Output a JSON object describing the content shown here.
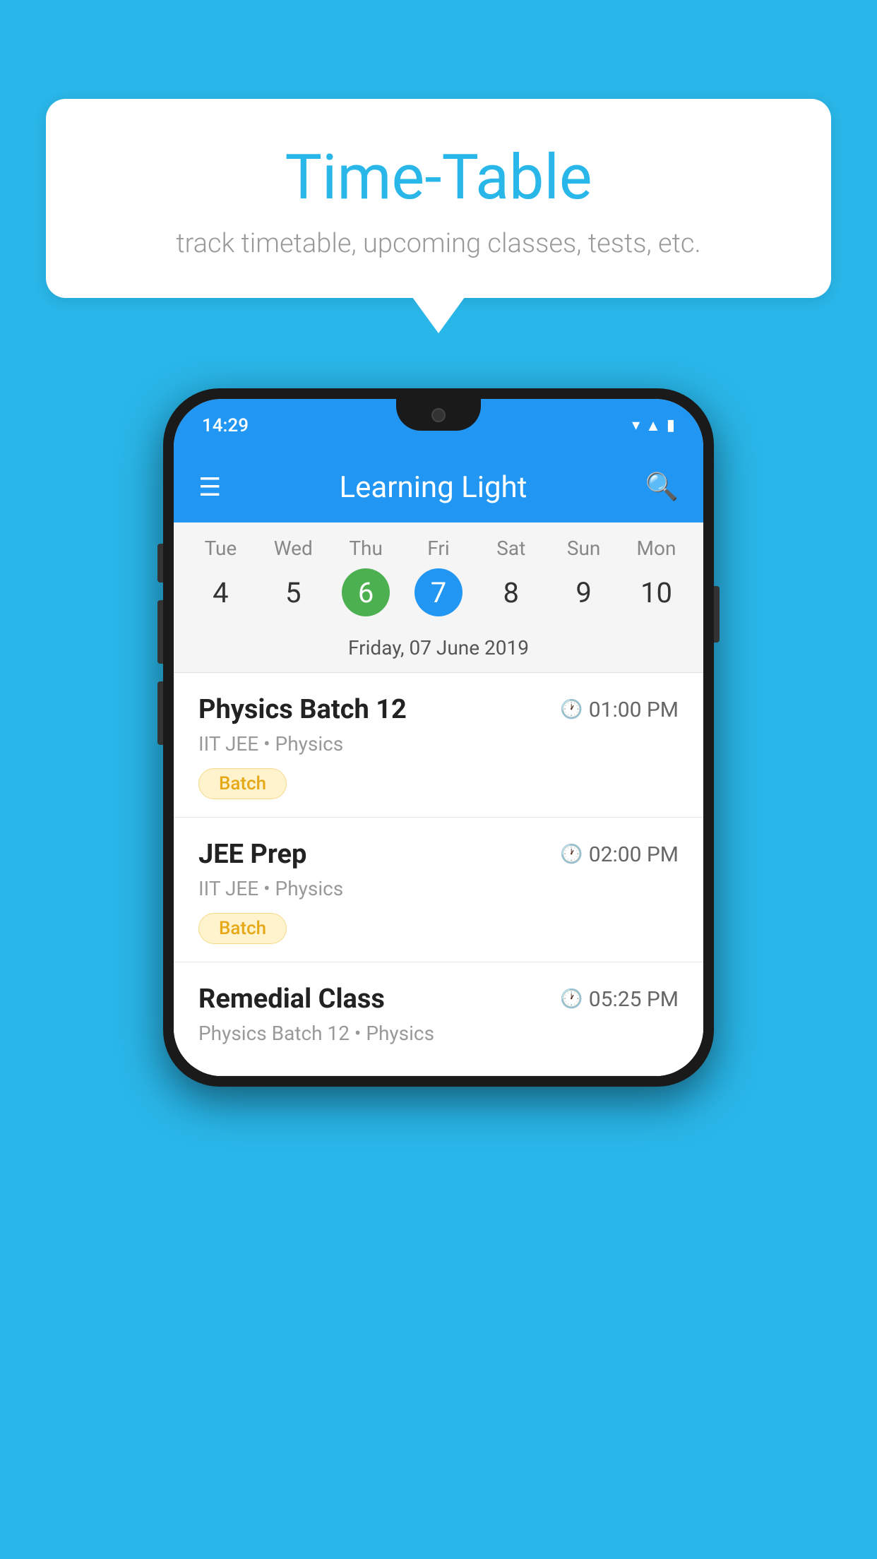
{
  "background_color": "#29B6E8",
  "bubble": {
    "title": "Time-Table",
    "subtitle": "track timetable, upcoming classes, tests, etc."
  },
  "phone": {
    "status_bar": {
      "time": "14:29"
    },
    "app_bar": {
      "title": "Learning Light"
    },
    "calendar": {
      "days": [
        {
          "name": "Tue",
          "num": "4",
          "state": "normal"
        },
        {
          "name": "Wed",
          "num": "5",
          "state": "normal"
        },
        {
          "name": "Thu",
          "num": "6",
          "state": "today"
        },
        {
          "name": "Fri",
          "num": "7",
          "state": "selected"
        },
        {
          "name": "Sat",
          "num": "8",
          "state": "normal"
        },
        {
          "name": "Sun",
          "num": "9",
          "state": "normal"
        },
        {
          "name": "Mon",
          "num": "10",
          "state": "normal"
        }
      ],
      "selected_date": "Friday, 07 June 2019"
    },
    "schedule": [
      {
        "title": "Physics Batch 12",
        "time": "01:00 PM",
        "subtitle": "IIT JEE • Physics",
        "badge": "Batch"
      },
      {
        "title": "JEE Prep",
        "time": "02:00 PM",
        "subtitle": "IIT JEE • Physics",
        "badge": "Batch"
      },
      {
        "title": "Remedial Class",
        "time": "05:25 PM",
        "subtitle": "Physics Batch 12 • Physics",
        "badge": null
      }
    ]
  }
}
